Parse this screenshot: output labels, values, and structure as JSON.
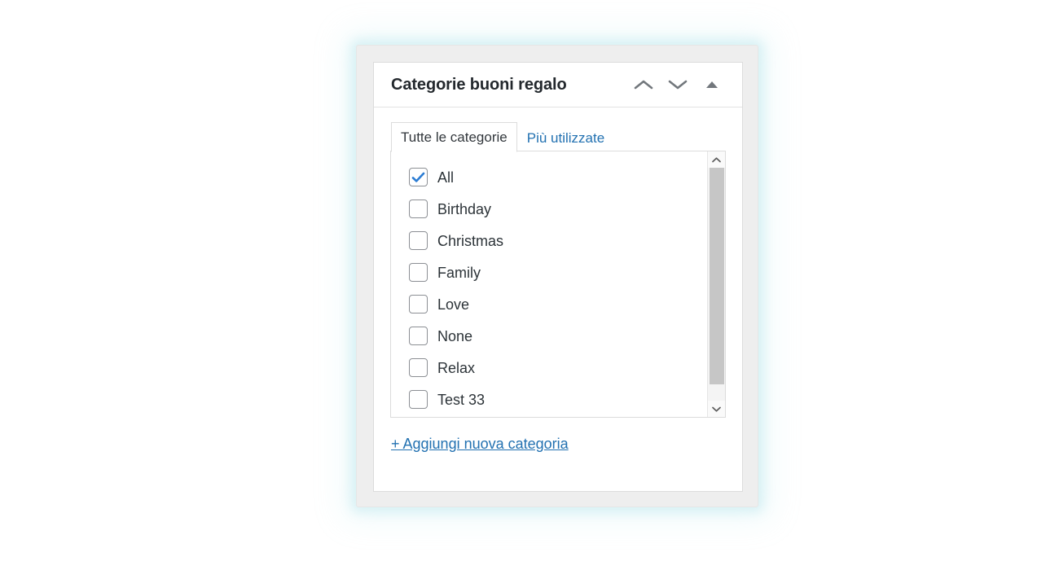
{
  "panel": {
    "title": "Categorie buoni regalo",
    "header_controls": [
      {
        "name": "move-up-icon",
        "label": "Sposta su"
      },
      {
        "name": "move-down-icon",
        "label": "Sposta giù"
      },
      {
        "name": "toggle-panel-icon",
        "label": "Attiva/disattiva pannello"
      }
    ]
  },
  "tabs": [
    {
      "label": "Tutte le categorie",
      "active": true
    },
    {
      "label": "Più utilizzate",
      "active": false
    }
  ],
  "checklist": {
    "items": [
      {
        "label": "All",
        "checked": true
      },
      {
        "label": "Birthday",
        "checked": false
      },
      {
        "label": "Christmas",
        "checked": false
      },
      {
        "label": "Family",
        "checked": false
      },
      {
        "label": "Love",
        "checked": false
      },
      {
        "label": "None",
        "checked": false
      },
      {
        "label": "Relax",
        "checked": false
      },
      {
        "label": "Test 33",
        "checked": false
      }
    ]
  },
  "scrollbar": {
    "up_arrow": "scroll-up-icon",
    "down_arrow": "scroll-down-icon"
  },
  "add_link": {
    "label": "+ Aggiungi nuova categoria"
  },
  "colors": {
    "accent_blue": "#2271b1",
    "check_blue": "#2b7cd3",
    "title_text": "#23282d",
    "item_text": "#2c3338",
    "panel_bg": "#eeeeee",
    "box_border": "#dcdcdc",
    "scroll_thumb": "#c6c6c6"
  }
}
